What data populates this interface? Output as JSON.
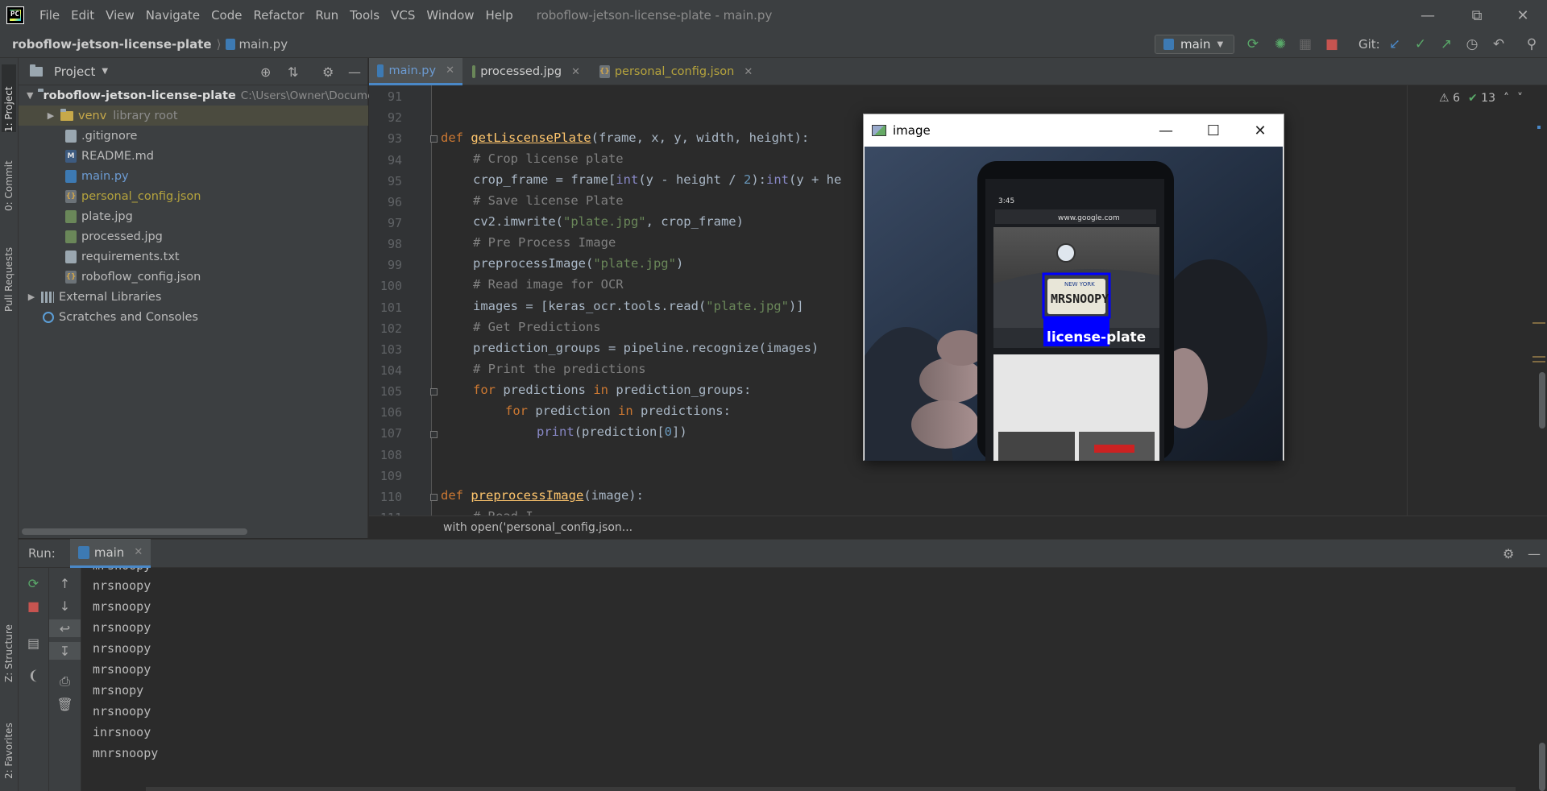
{
  "menubar": {
    "items": [
      "File",
      "Edit",
      "View",
      "Navigate",
      "Code",
      "Refactor",
      "Run",
      "Tools",
      "VCS",
      "Window",
      "Help"
    ],
    "window_title": "roboflow-jetson-license-plate - main.py"
  },
  "navbar": {
    "project": "roboflow-jetson-license-plate",
    "file": "main.py",
    "branch": "main",
    "git_label": "Git:"
  },
  "left_strip": {
    "tabs": [
      "1: Project",
      "0: Commit",
      "Pull Requests",
      "Z: Structure",
      "2: Favorites"
    ]
  },
  "project_panel": {
    "title": "Project",
    "root_name": "roboflow-jetson-license-plate",
    "root_path": "C:\\Users\\Owner\\Docume",
    "venv_name": "venv",
    "venv_note": "library root",
    "files": [
      ".gitignore",
      "README.md",
      "main.py",
      "personal_config.json",
      "plate.jpg",
      "processed.jpg",
      "requirements.txt",
      "roboflow_config.json"
    ],
    "external_libraries": "External Libraries",
    "scratches": "Scratches and Consoles"
  },
  "editor_tabs": [
    "main.py",
    "processed.jpg",
    "personal_config.json"
  ],
  "editor": {
    "line_numbers": [
      "91",
      "92",
      "93",
      "94",
      "95",
      "96",
      "97",
      "98",
      "99",
      "100",
      "101",
      "102",
      "103",
      "104",
      "105",
      "106",
      "107",
      "108",
      "109",
      "110",
      "111"
    ],
    "warnings": "6",
    "weak_warnings": "13",
    "code": {
      "l93_kw": "def ",
      "l93_fn": "getLiscensePlate",
      "l93_rest": "(frame, x, y, width, height):",
      "l94": "# Crop license plate",
      "l95_a": "crop_frame = frame[",
      "l95_b": "int",
      "l95_c": "(y - height / ",
      "l95_d": "2",
      "l95_e": "):",
      "l95_f": "int",
      "l95_g": "(y + he",
      "l96": "# Save license Plate",
      "l97_a": "cv2.imwrite(",
      "l97_b": "\"plate.jpg\"",
      "l97_c": ", crop_frame)",
      "l98": "# Pre Process Image",
      "l99_a": "preprocessImage(",
      "l99_b": "\"plate.jpg\"",
      "l99_c": ")",
      "l100": "# Read image for OCR",
      "l101_a": "images = [keras_ocr.tools.read(",
      "l101_b": "\"plate.jpg\"",
      "l101_c": ")]",
      "l102": "# Get Predictions",
      "l103": "prediction_groups = pipeline.recognize(images)",
      "l104": "# Print the predictions",
      "l105_kw": "for ",
      "l105_a": "predictions ",
      "l105_in": "in ",
      "l105_b": "prediction_groups:",
      "l106_kw": "for ",
      "l106_a": "prediction ",
      "l106_in": "in ",
      "l106_b": "predictions:",
      "l107_a": "print",
      "l107_b": "(prediction[",
      "l107_c": "0",
      "l107_d": "])",
      "l110_kw": "def ",
      "l110_fn": "preprocessImage",
      "l110_rest": "(image):",
      "l111": "# Read I"
    },
    "hint": "with open('personal_config.json..."
  },
  "image_window": {
    "title": "image",
    "detection_label": "license-plate",
    "plate_text": "MRSNOOPY",
    "plate_state": "NEW YORK",
    "phone_url": "www.google.com",
    "phone_time": "3:45"
  },
  "run_panel": {
    "label": "Run:",
    "tab": "main",
    "output": [
      "mrsnoopy",
      "nrsnoopy",
      "mrsnoopy",
      "nrsnoopy",
      "nrsnoopy",
      "mrsnoopy",
      "mrsnopy",
      "nrsnoopy",
      "inrsnooy",
      "mnrsnoopy"
    ]
  },
  "colors": {
    "accent": "#4a88c7",
    "detection_box": "#0000ff"
  }
}
